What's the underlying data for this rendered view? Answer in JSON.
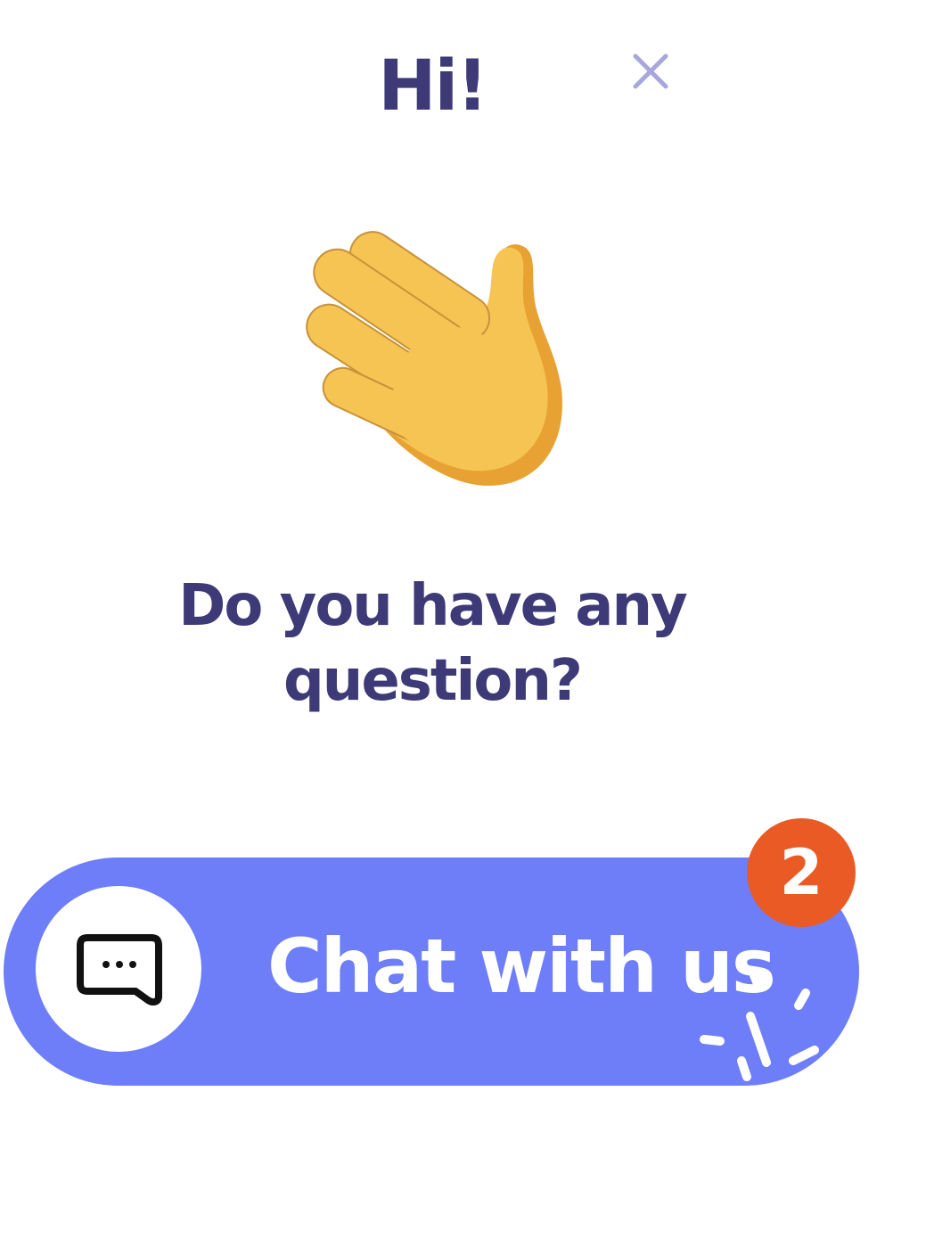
{
  "popup": {
    "greeting": "Hi!",
    "question_line1": "Do you have any",
    "question_line2": "question?",
    "wave_icon": "waving-hand-emoji",
    "close_icon": "close-x-icon"
  },
  "chat_button": {
    "label": "Chat with us",
    "icon": "chat-bubble-icon",
    "badge_count": "2"
  },
  "colors": {
    "heading_text": "#3e3a78",
    "button_background": "#6e7ef8",
    "badge_background": "#ea5a24",
    "close_icon": "#a9a6dc",
    "hand": "#f6c453",
    "hand_shadow": "#e7a233"
  }
}
